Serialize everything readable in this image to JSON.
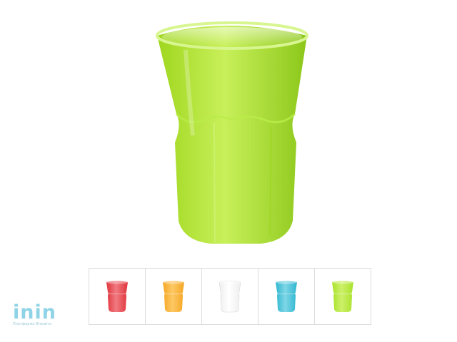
{
  "product": {
    "main_color": "#a9e22a",
    "main_color_light": "#c8f05a",
    "main_color_dark": "#8cc71a"
  },
  "thumbnails": [
    {
      "name": "red",
      "color": "#e0343c",
      "light": "#f07a80"
    },
    {
      "name": "orange",
      "color": "#f5a623",
      "light": "#fcc865"
    },
    {
      "name": "clear",
      "color": "#eeeeee",
      "light": "#ffffff"
    },
    {
      "name": "blue",
      "color": "#2eb6cf",
      "light": "#7fd6e6"
    },
    {
      "name": "green",
      "color": "#a9e22a",
      "light": "#cdf06a"
    }
  ],
  "logo": {
    "text": "inin",
    "tagline": "Платформа Инвайта",
    "color": "#8fd3e6"
  }
}
